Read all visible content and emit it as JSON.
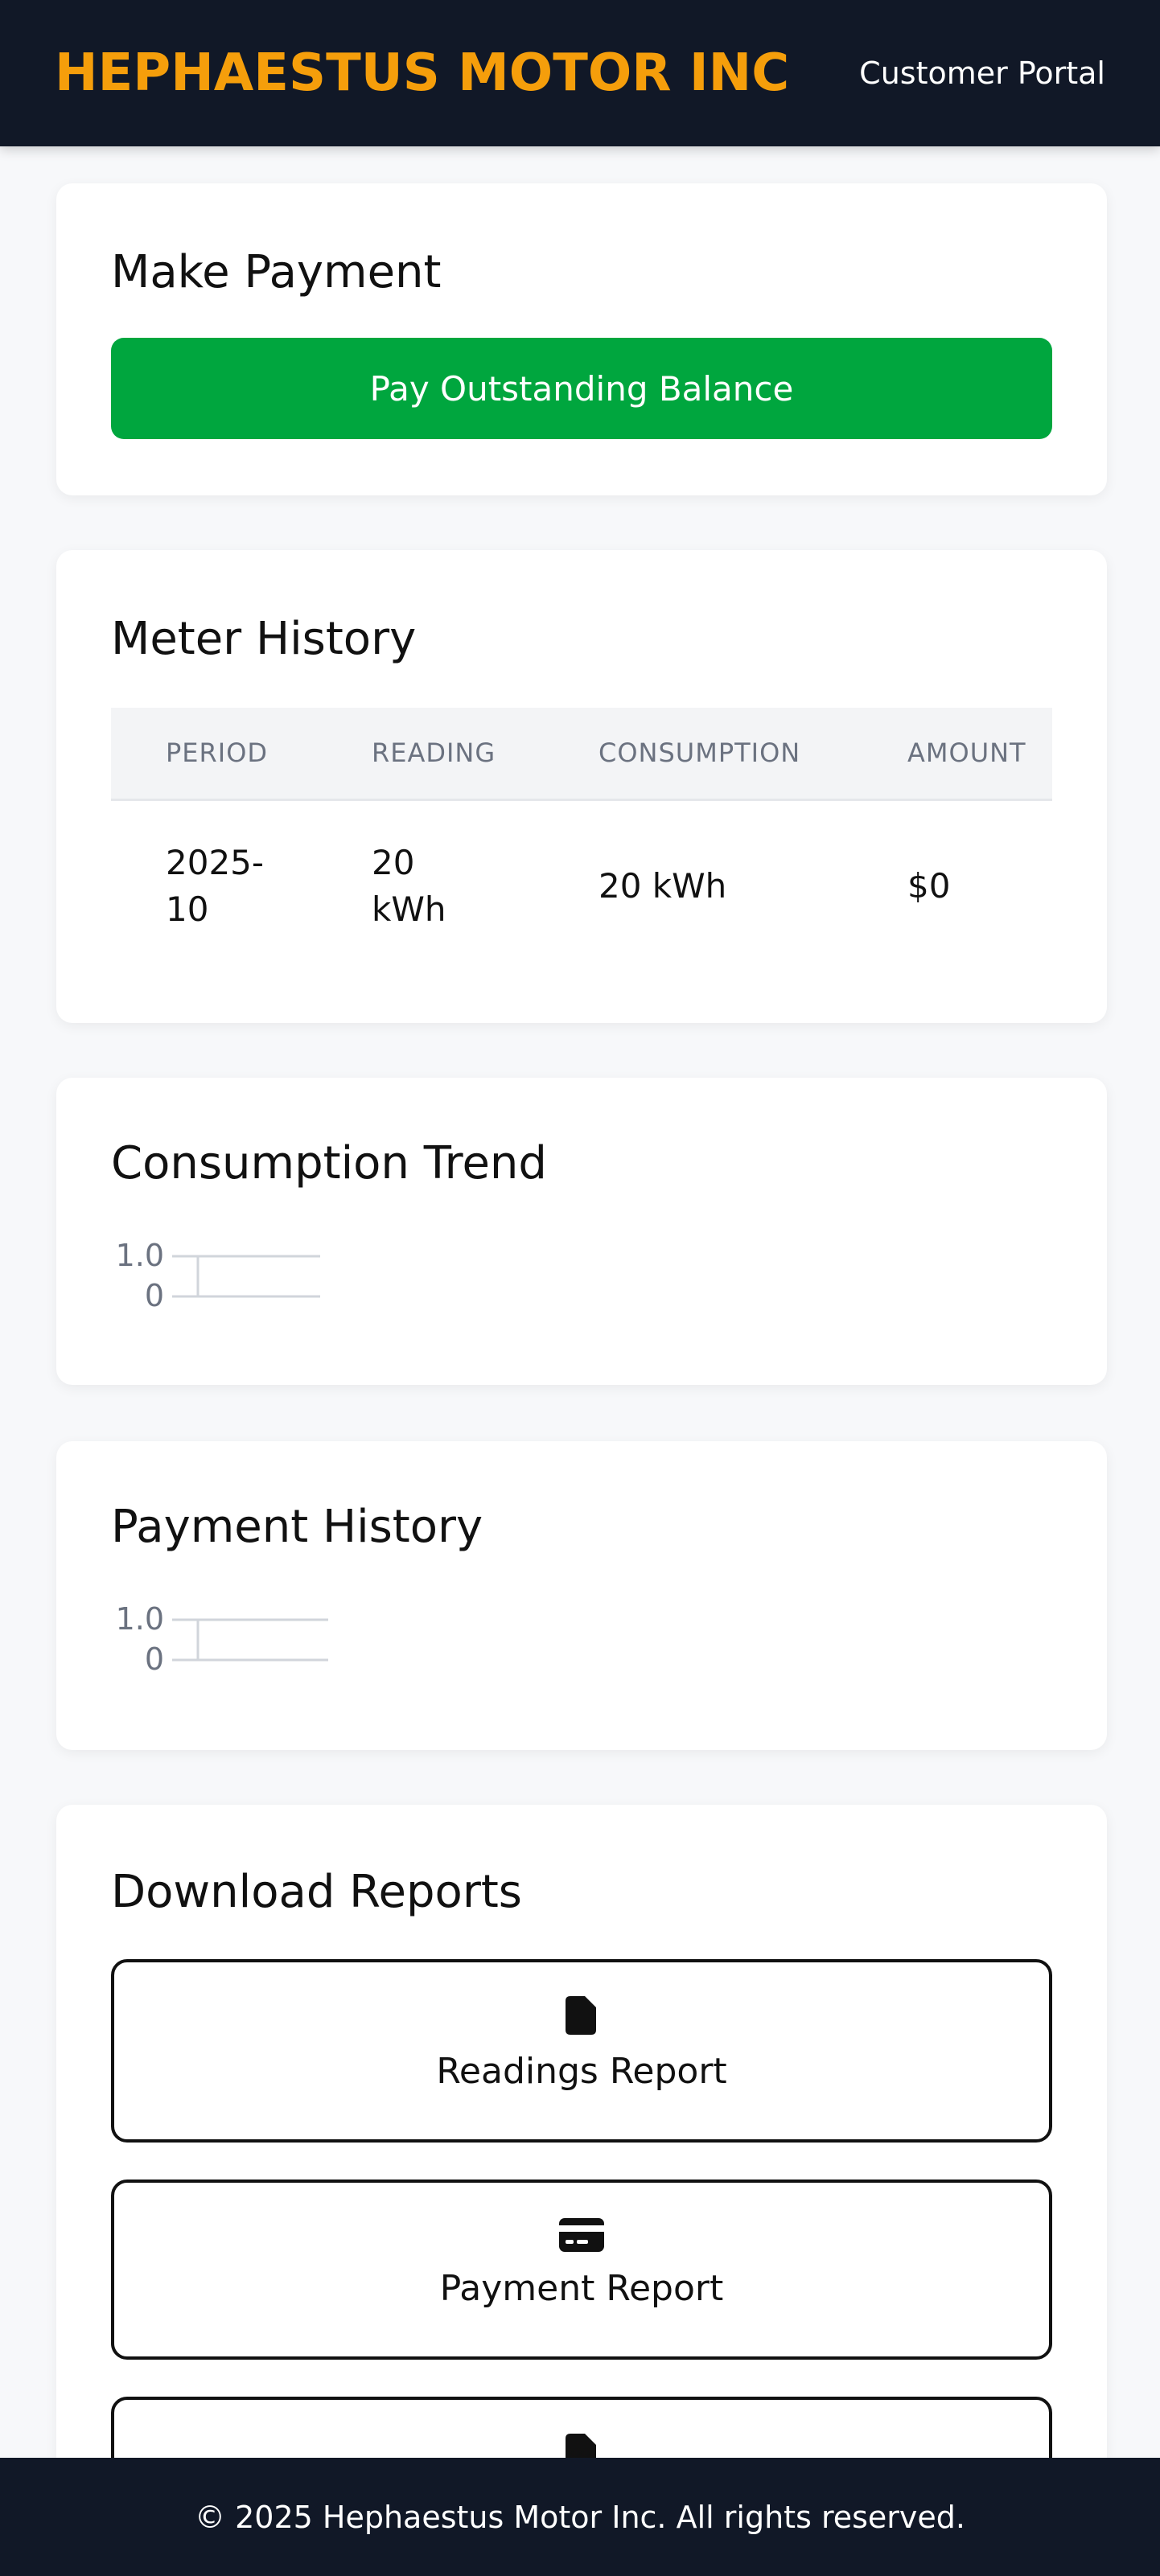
{
  "header": {
    "brand": "HEPHAESTUS MOTOR INC",
    "portal_label": "Customer Portal"
  },
  "payment": {
    "title": "Make Payment",
    "button_label": "Pay Outstanding Balance"
  },
  "meter_history": {
    "title": "Meter History",
    "columns": [
      "PERIOD",
      "READING",
      "CONSUMPTION",
      "AMOUNT"
    ],
    "rows": [
      {
        "period": "2025-10",
        "reading": "20 kWh",
        "consumption": "20 kWh",
        "amount": "$0"
      }
    ]
  },
  "consumption_trend": {
    "title": "Consumption Trend",
    "y_ticks": [
      "1.0",
      "0"
    ]
  },
  "payment_history": {
    "title": "Payment History",
    "y_ticks": [
      "1.0",
      "0"
    ]
  },
  "reports": {
    "title": "Download Reports",
    "items": [
      {
        "label": "Readings Report",
        "icon": "file-icon"
      },
      {
        "label": "Payment Report",
        "icon": "credit-card-icon"
      },
      {
        "label": "",
        "icon": "file-icon"
      }
    ]
  },
  "footer": {
    "copyright": "© 2025 Hephaestus Motor Inc. All rights reserved."
  },
  "colors": {
    "header_bg": "#111827",
    "brand": "#f59e0b",
    "pay_button": "#00a63e"
  }
}
